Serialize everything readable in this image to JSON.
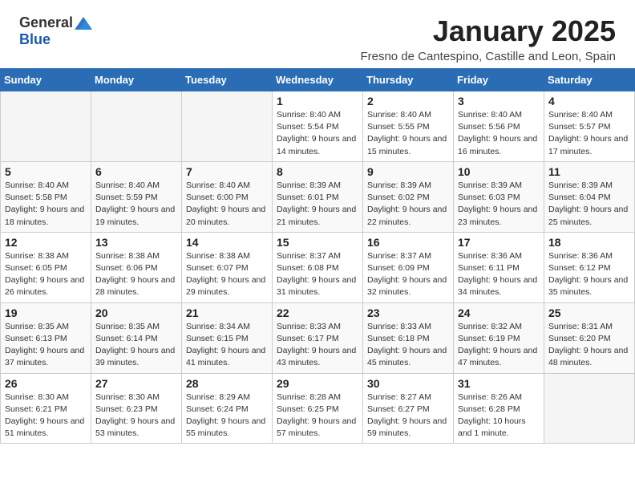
{
  "logo": {
    "general": "General",
    "blue": "Blue"
  },
  "title": "January 2025",
  "location": "Fresno de Cantespino, Castille and Leon, Spain",
  "weekdays": [
    "Sunday",
    "Monday",
    "Tuesday",
    "Wednesday",
    "Thursday",
    "Friday",
    "Saturday"
  ],
  "weeks": [
    [
      {
        "day": "",
        "info": ""
      },
      {
        "day": "",
        "info": ""
      },
      {
        "day": "",
        "info": ""
      },
      {
        "day": "1",
        "info": "Sunrise: 8:40 AM\nSunset: 5:54 PM\nDaylight: 9 hours and 14 minutes."
      },
      {
        "day": "2",
        "info": "Sunrise: 8:40 AM\nSunset: 5:55 PM\nDaylight: 9 hours and 15 minutes."
      },
      {
        "day": "3",
        "info": "Sunrise: 8:40 AM\nSunset: 5:56 PM\nDaylight: 9 hours and 16 minutes."
      },
      {
        "day": "4",
        "info": "Sunrise: 8:40 AM\nSunset: 5:57 PM\nDaylight: 9 hours and 17 minutes."
      }
    ],
    [
      {
        "day": "5",
        "info": "Sunrise: 8:40 AM\nSunset: 5:58 PM\nDaylight: 9 hours and 18 minutes."
      },
      {
        "day": "6",
        "info": "Sunrise: 8:40 AM\nSunset: 5:59 PM\nDaylight: 9 hours and 19 minutes."
      },
      {
        "day": "7",
        "info": "Sunrise: 8:40 AM\nSunset: 6:00 PM\nDaylight: 9 hours and 20 minutes."
      },
      {
        "day": "8",
        "info": "Sunrise: 8:39 AM\nSunset: 6:01 PM\nDaylight: 9 hours and 21 minutes."
      },
      {
        "day": "9",
        "info": "Sunrise: 8:39 AM\nSunset: 6:02 PM\nDaylight: 9 hours and 22 minutes."
      },
      {
        "day": "10",
        "info": "Sunrise: 8:39 AM\nSunset: 6:03 PM\nDaylight: 9 hours and 23 minutes."
      },
      {
        "day": "11",
        "info": "Sunrise: 8:39 AM\nSunset: 6:04 PM\nDaylight: 9 hours and 25 minutes."
      }
    ],
    [
      {
        "day": "12",
        "info": "Sunrise: 8:38 AM\nSunset: 6:05 PM\nDaylight: 9 hours and 26 minutes."
      },
      {
        "day": "13",
        "info": "Sunrise: 8:38 AM\nSunset: 6:06 PM\nDaylight: 9 hours and 28 minutes."
      },
      {
        "day": "14",
        "info": "Sunrise: 8:38 AM\nSunset: 6:07 PM\nDaylight: 9 hours and 29 minutes."
      },
      {
        "day": "15",
        "info": "Sunrise: 8:37 AM\nSunset: 6:08 PM\nDaylight: 9 hours and 31 minutes."
      },
      {
        "day": "16",
        "info": "Sunrise: 8:37 AM\nSunset: 6:09 PM\nDaylight: 9 hours and 32 minutes."
      },
      {
        "day": "17",
        "info": "Sunrise: 8:36 AM\nSunset: 6:11 PM\nDaylight: 9 hours and 34 minutes."
      },
      {
        "day": "18",
        "info": "Sunrise: 8:36 AM\nSunset: 6:12 PM\nDaylight: 9 hours and 35 minutes."
      }
    ],
    [
      {
        "day": "19",
        "info": "Sunrise: 8:35 AM\nSunset: 6:13 PM\nDaylight: 9 hours and 37 minutes."
      },
      {
        "day": "20",
        "info": "Sunrise: 8:35 AM\nSunset: 6:14 PM\nDaylight: 9 hours and 39 minutes."
      },
      {
        "day": "21",
        "info": "Sunrise: 8:34 AM\nSunset: 6:15 PM\nDaylight: 9 hours and 41 minutes."
      },
      {
        "day": "22",
        "info": "Sunrise: 8:33 AM\nSunset: 6:17 PM\nDaylight: 9 hours and 43 minutes."
      },
      {
        "day": "23",
        "info": "Sunrise: 8:33 AM\nSunset: 6:18 PM\nDaylight: 9 hours and 45 minutes."
      },
      {
        "day": "24",
        "info": "Sunrise: 8:32 AM\nSunset: 6:19 PM\nDaylight: 9 hours and 47 minutes."
      },
      {
        "day": "25",
        "info": "Sunrise: 8:31 AM\nSunset: 6:20 PM\nDaylight: 9 hours and 48 minutes."
      }
    ],
    [
      {
        "day": "26",
        "info": "Sunrise: 8:30 AM\nSunset: 6:21 PM\nDaylight: 9 hours and 51 minutes."
      },
      {
        "day": "27",
        "info": "Sunrise: 8:30 AM\nSunset: 6:23 PM\nDaylight: 9 hours and 53 minutes."
      },
      {
        "day": "28",
        "info": "Sunrise: 8:29 AM\nSunset: 6:24 PM\nDaylight: 9 hours and 55 minutes."
      },
      {
        "day": "29",
        "info": "Sunrise: 8:28 AM\nSunset: 6:25 PM\nDaylight: 9 hours and 57 minutes."
      },
      {
        "day": "30",
        "info": "Sunrise: 8:27 AM\nSunset: 6:27 PM\nDaylight: 9 hours and 59 minutes."
      },
      {
        "day": "31",
        "info": "Sunrise: 8:26 AM\nSunset: 6:28 PM\nDaylight: 10 hours and 1 minute."
      },
      {
        "day": "",
        "info": ""
      }
    ]
  ]
}
